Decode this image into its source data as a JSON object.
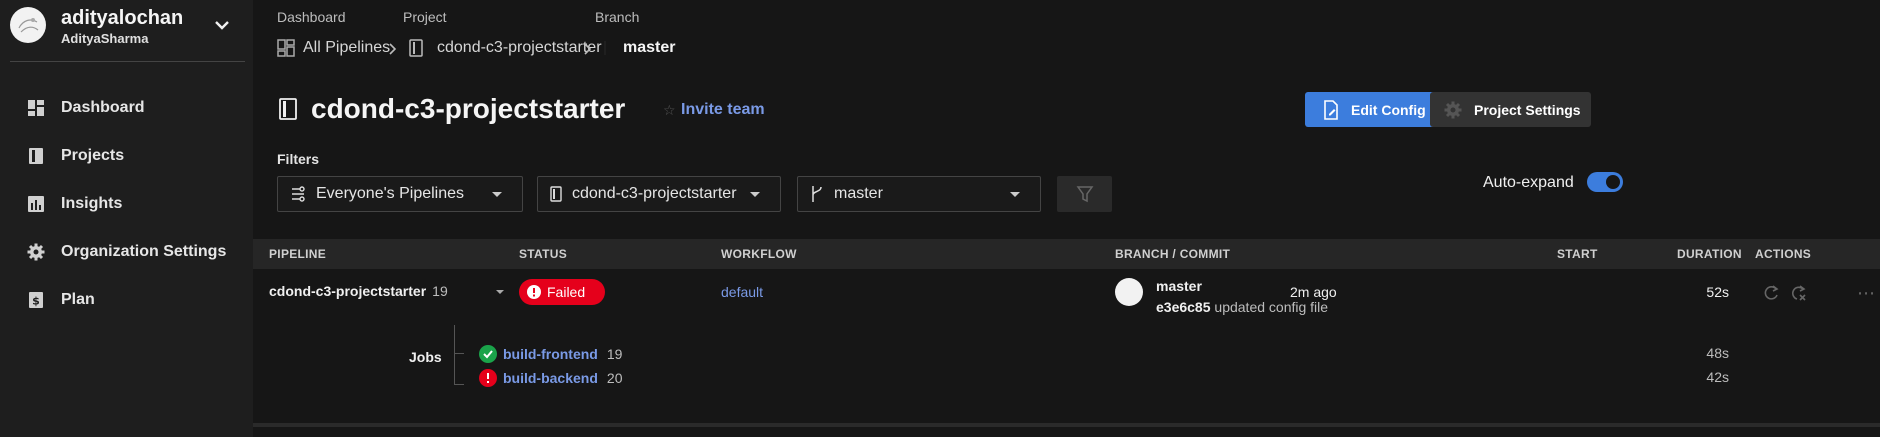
{
  "org": {
    "name": "adityalochan",
    "user": "AdityaSharma"
  },
  "nav": [
    {
      "label": "Dashboard",
      "icon": "dashboard-icon"
    },
    {
      "label": "Projects",
      "icon": "projects-icon"
    },
    {
      "label": "Insights",
      "icon": "insights-icon"
    },
    {
      "label": "Organization Settings",
      "icon": "gear-icon"
    },
    {
      "label": "Plan",
      "icon": "plan-icon"
    }
  ],
  "breadcrumb": {
    "labels": {
      "dashboard": "Dashboard",
      "project": "Project",
      "branch": "Branch"
    },
    "all_pipelines": "All Pipelines",
    "project": "cdond-c3-projectstarter",
    "branch": "master"
  },
  "page": {
    "title": "cdond-c3-projectstarter",
    "invite": "Invite team",
    "edit_config": "Edit Config",
    "project_settings": "Project Settings"
  },
  "filters": {
    "label": "Filters",
    "pipelines": "Everyone's Pipelines",
    "project": "cdond-c3-projectstarter",
    "branch": "master",
    "auto_expand": "Auto-expand"
  },
  "table": {
    "headers": {
      "pipeline": "PIPELINE",
      "status": "STATUS",
      "workflow": "WORKFLOW",
      "branch_commit": "BRANCH / COMMIT",
      "start": "START",
      "duration": "DURATION",
      "actions": "ACTIONS"
    },
    "row": {
      "pipeline": "cdond-c3-projectstarter",
      "number": "19",
      "status": "Failed",
      "workflow": "default",
      "branch": "master",
      "commit_sha": "e3e6c85",
      "commit_msg": "updated config file",
      "start": "2m ago",
      "duration": "52s",
      "jobs_label": "Jobs",
      "jobs": [
        {
          "name": "build-frontend",
          "number": "19",
          "duration": "48s",
          "status": "success"
        },
        {
          "name": "build-backend",
          "number": "20",
          "duration": "42s",
          "status": "failed"
        }
      ]
    }
  },
  "colors": {
    "accent": "#3c7ddd",
    "link": "#7a9ae6",
    "failed": "#e5001b",
    "success": "#1aa34a"
  }
}
